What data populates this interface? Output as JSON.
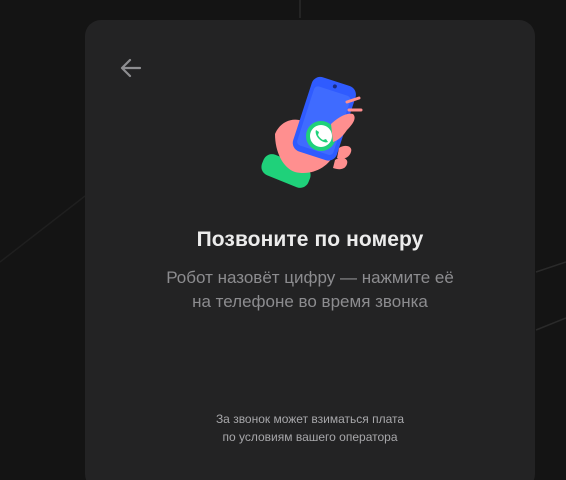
{
  "dialog": {
    "back_icon": "arrow-left-icon",
    "illustration_icon": "hand-holding-phone-icon",
    "title": "Позвоните по номеру",
    "subtitle_line1": "Робот назовёт цифру — нажмите её",
    "subtitle_line2": "на телефоне во время звонка",
    "note_line1": "За звонок может взиматься плата",
    "note_line2": "по условиям вашего оператора"
  },
  "colors": {
    "page_background": "#141414",
    "card_background": "#232324",
    "title": "#ececec",
    "subtitle": "#8c8c8f",
    "note": "#a7a7aa",
    "phone_blue": "#2f5bff",
    "call_green": "#1fd17a",
    "hand_pink": "#ff8f8f"
  }
}
